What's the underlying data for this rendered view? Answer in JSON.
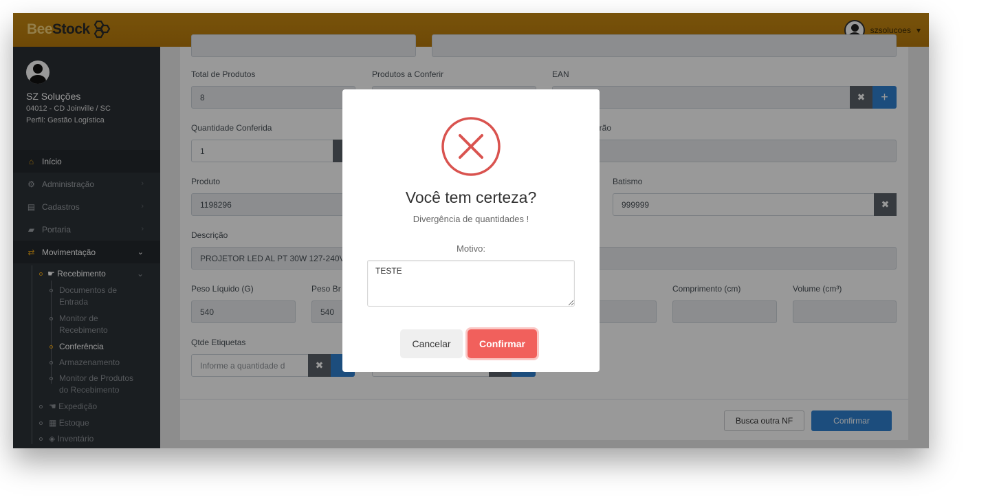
{
  "brand": {
    "prefix": "Bee",
    "name": "Stock"
  },
  "user": {
    "name": "szsolucoes",
    "caret": "▾"
  },
  "profile": {
    "name": "SZ Soluções",
    "location": "04012 - CD Joinville / SC",
    "role": "Perfil: Gestão Logística"
  },
  "sidebar": {
    "items": [
      {
        "label": "Início",
        "icon": "home-icon"
      },
      {
        "label": "Administração",
        "icon": "cogs-icon"
      },
      {
        "label": "Cadastros",
        "icon": "list-icon"
      },
      {
        "label": "Portaria",
        "icon": "truck-icon"
      },
      {
        "label": "Movimentação",
        "icon": "exchange-icon"
      }
    ],
    "recebimento": "Recebimento",
    "sub": [
      "Documentos de",
      "Entrada",
      "Monitor de",
      "Recebimento",
      "Conferência",
      "Armazenamento",
      "Monitor de Produtos",
      "do Recebimento"
    ],
    "groups": [
      "Expedição",
      "Estoque",
      "Inventário"
    ]
  },
  "form": {
    "total_label": "Total de Produtos",
    "total_value": "8",
    "conferir_label": "Produtos a Conferir",
    "ean_label": "EAN",
    "qtd_label": "Quantidade Conferida",
    "qtd_value": "1",
    "padrao_label_partial": "drão",
    "produto_label": "Produto",
    "produto_value": "1198296",
    "batismo_label": "Batismo",
    "batismo_value": "999999",
    "descricao_label": "Descrição",
    "descricao_value": "PROJETOR LED AL PT 30W 127-240V 6!",
    "peso_liq_label": "Peso Líquido (G)",
    "peso_liq_value": "540",
    "peso_bru_label": "Peso Br",
    "peso_bru_value": "540",
    "comprimento_label": "Comprimento (cm)",
    "volume_label": "Volume (cm³)",
    "etiquetas_label": "Qtde Etiquetas",
    "etiquetas_placeholder": "Informe a quantidade d",
    "x_glyph": "✖",
    "plus_glyph": "+"
  },
  "footer": {
    "busca": "Busca outra NF",
    "confirmar": "Confirmar"
  },
  "modal": {
    "title": "Você tem certeza?",
    "text": "Divergência de quantidades !",
    "motivo_label": "Motivo:",
    "motivo_value": "TESTE",
    "cancel": "Cancelar",
    "confirm": "Confirmar",
    "icon": "error-x-icon",
    "accent": "#f1605c"
  }
}
